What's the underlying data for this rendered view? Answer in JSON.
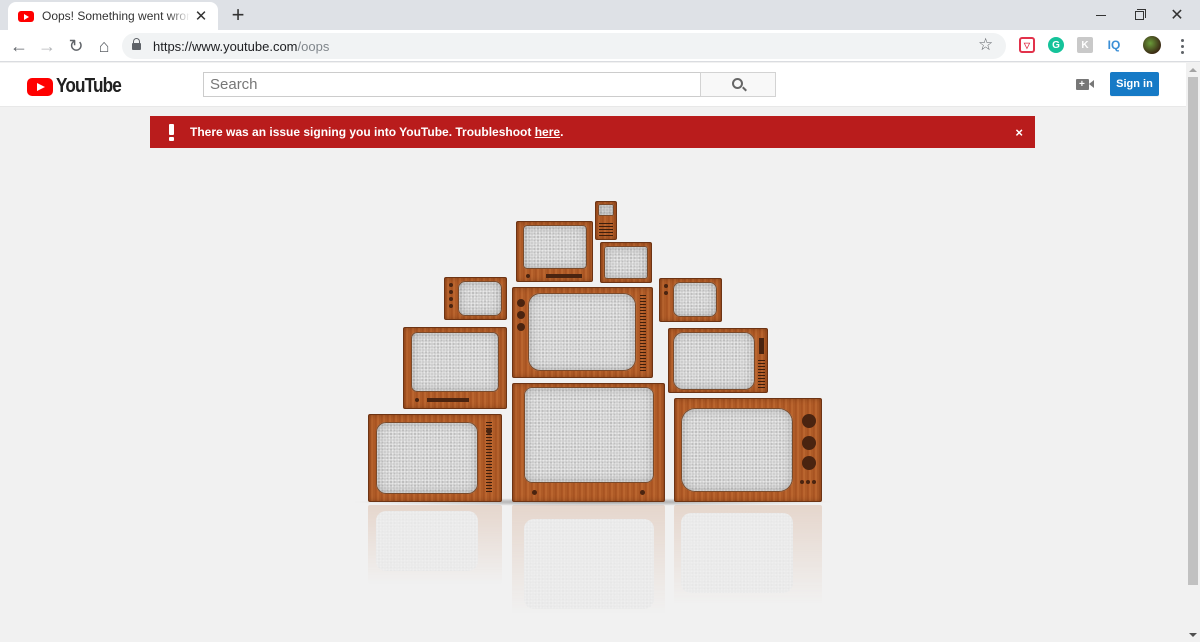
{
  "browser": {
    "tab": {
      "title": "Oops! Something went wrong. - YouTube",
      "close": "✕"
    },
    "new_tab": "+",
    "window": {
      "close": "✕"
    },
    "nav": {
      "back": "←",
      "forward": "→",
      "reload": "↻",
      "home": "⌂"
    },
    "url": {
      "host": "https://www.youtube.com",
      "path": "/oops"
    },
    "star": "☆",
    "extensions": {
      "pocket": "▽",
      "grammarly": "G",
      "k": "K",
      "iq": "IQ"
    }
  },
  "masthead": {
    "logo_text": "YouTube",
    "search_placeholder": "Search",
    "signin_label": "Sign in"
  },
  "alert": {
    "message": "There was an issue signing you into YouTube. Troubleshoot ",
    "link_text": "here",
    "suffix": ".",
    "close": "×"
  },
  "colors": {
    "youtube_red": "#ff0000",
    "alert_bg": "#b91c1c",
    "signin_blue": "#167ac6",
    "page_bg": "#f1f1f1",
    "tv_wood": "#b25f2a"
  }
}
